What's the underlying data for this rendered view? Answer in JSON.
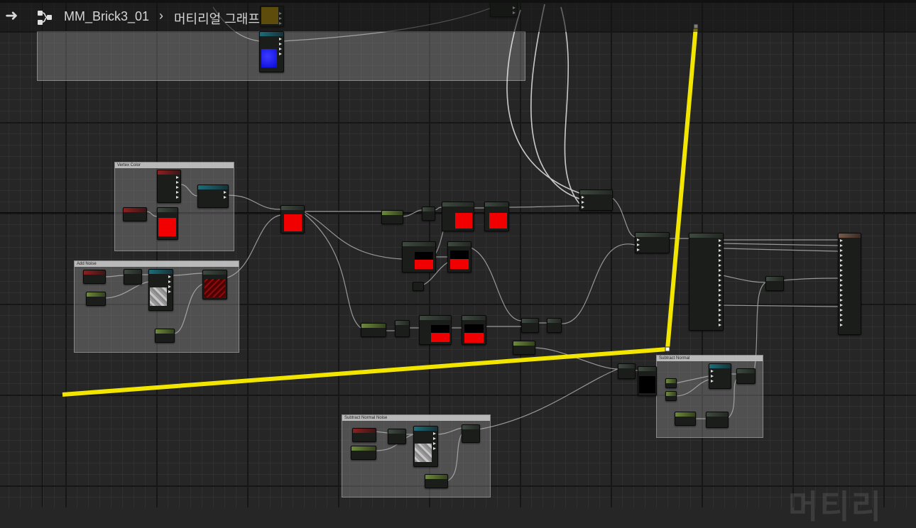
{
  "breadcrumb": {
    "asset": "MM_Brick3_01",
    "separator": "›",
    "graph": "머티리얼 그래프"
  },
  "comments": {
    "vertex_color": "Vertex Color",
    "add_noise": "Add Noise",
    "subtract_normal": "Subtract Normal",
    "subtract_normal_noise": "Subtract Normal Noise"
  },
  "watermark": "머티리",
  "colors": {
    "highlight_line": "#ffee00",
    "preview_red": "#f00000",
    "preview_blue": "#1212e0"
  }
}
